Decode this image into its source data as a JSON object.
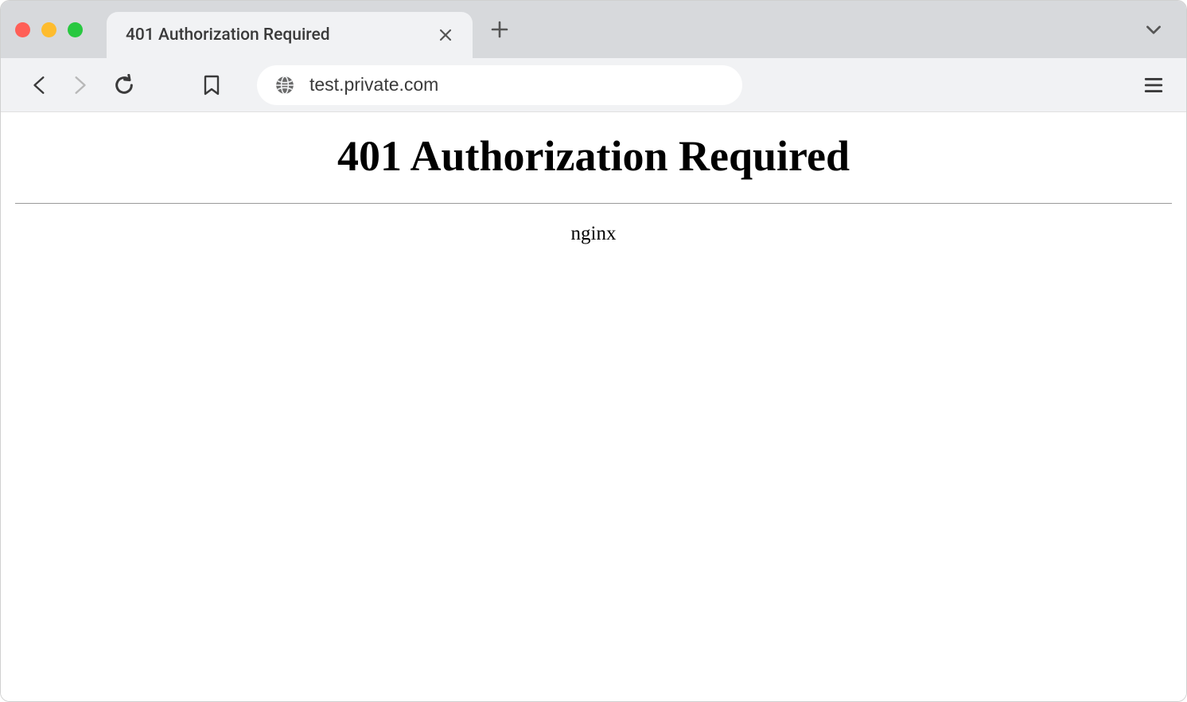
{
  "tab": {
    "title": "401 Authorization Required"
  },
  "url": "test.private.com",
  "page": {
    "heading": "401 Authorization Required",
    "server": "nginx"
  }
}
